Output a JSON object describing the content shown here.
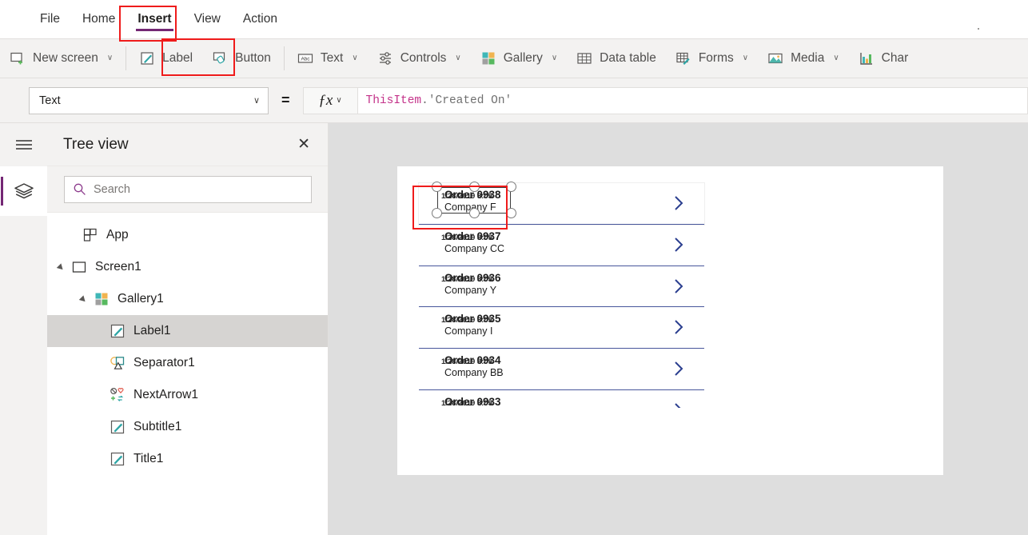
{
  "menu": {
    "items": [
      {
        "label": "File",
        "active": false
      },
      {
        "label": "Home",
        "active": false
      },
      {
        "label": "Insert",
        "active": true
      },
      {
        "label": "View",
        "active": false
      },
      {
        "label": "Action",
        "active": false
      }
    ]
  },
  "ribbon": {
    "items": [
      {
        "label": "New screen",
        "icon": "new-screen-icon",
        "caret": "∨"
      },
      {
        "label": "Label",
        "icon": "label-icon",
        "caret": ""
      },
      {
        "label": "Button",
        "icon": "button-icon",
        "caret": ""
      },
      {
        "label": "Text",
        "icon": "text-abc-icon",
        "caret": "∨"
      },
      {
        "label": "Controls",
        "icon": "controls-sliders-icon",
        "caret": "∨"
      },
      {
        "label": "Gallery",
        "icon": "gallery-grid-icon",
        "caret": "∨"
      },
      {
        "label": "Data table",
        "icon": "data-table-icon",
        "caret": ""
      },
      {
        "label": "Forms",
        "icon": "forms-icon",
        "caret": "∨"
      },
      {
        "label": "Media",
        "icon": "media-image-icon",
        "caret": "∨"
      },
      {
        "label": "Char",
        "icon": "charts-icon",
        "caret": ""
      }
    ]
  },
  "formula_bar": {
    "property": "Text",
    "property_caret": "∨",
    "equals": "=",
    "fx_glyph": "ƒx",
    "fx_caret": "∨",
    "formula_object": "ThisItem",
    "formula_rest": ".'Created On'"
  },
  "tree_panel": {
    "title": "Tree view",
    "close_label": "✕",
    "search_placeholder": "Search",
    "items": [
      {
        "label": "App",
        "indent": 0,
        "icon": "app-icon",
        "arrow": false,
        "selected": false
      },
      {
        "label": "Screen1",
        "indent": 0,
        "icon": "screen-icon",
        "arrow": true,
        "selected": false
      },
      {
        "label": "Gallery1",
        "indent": 1,
        "icon": "gallery-grid-icon",
        "arrow": true,
        "selected": false
      },
      {
        "label": "Label1",
        "indent": 2,
        "icon": "label-pencil-icon",
        "arrow": false,
        "selected": true
      },
      {
        "label": "Separator1",
        "indent": 2,
        "icon": "separator-shapes-icon",
        "arrow": false,
        "selected": false
      },
      {
        "label": "NextArrow1",
        "indent": 2,
        "icon": "next-arrow-icons-icon",
        "arrow": false,
        "selected": false
      },
      {
        "label": "Subtitle1",
        "indent": 2,
        "icon": "label-pencil-icon",
        "arrow": false,
        "selected": false
      },
      {
        "label": "Title1",
        "indent": 2,
        "icon": "label-pencil-icon",
        "arrow": false,
        "selected": false
      }
    ]
  },
  "canvas": {
    "gallery_rows": [
      {
        "title": "Order 0938",
        "date": "1/28/2019 8:05",
        "subtitle": "Company F",
        "selected": true,
        "chevron_clipped": false
      },
      {
        "title": "Order 0937",
        "date": "1/28/2019 8:05",
        "subtitle": "Company CC",
        "selected": false,
        "chevron_clipped": false
      },
      {
        "title": "Order 0936",
        "date": "1/28/2019 8:05",
        "subtitle": "Company Y",
        "selected": false,
        "chevron_clipped": false
      },
      {
        "title": "Order 0935",
        "date": "1/28/2019 8:05",
        "subtitle": "Company I",
        "selected": false,
        "chevron_clipped": false
      },
      {
        "title": "Order 0934",
        "date": "1/28/2019 8:05",
        "subtitle": "Company BB",
        "selected": false,
        "chevron_clipped": false
      },
      {
        "title": "Order 0933",
        "date": "1/28/2019 8:05",
        "subtitle": "",
        "selected": false,
        "chevron_clipped": true
      }
    ]
  },
  "colors": {
    "accent_purple": "#742774",
    "ribbon_bg": "#f3f2f1",
    "canvas_bg": "#dedede",
    "chevron_blue": "#2b3f8f",
    "annotation_red": "#ef1b1b",
    "formula_object": "#c4338a"
  }
}
